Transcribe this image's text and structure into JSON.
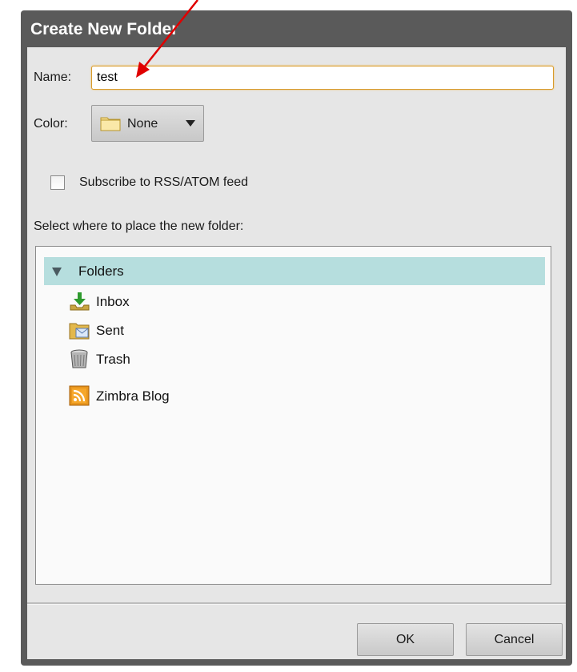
{
  "dialog": {
    "title": "Create New Folder",
    "name_label": "Name:",
    "name_value": "test",
    "color_label": "Color:",
    "color_value": "None",
    "subscribe_label": "Subscribe to RSS/ATOM feed",
    "placement_label": "Select where to place the new folder:",
    "ok_label": "OK",
    "cancel_label": "Cancel"
  },
  "tree": {
    "root": "Folders",
    "items": [
      {
        "label": "Inbox",
        "icon": "inbox-icon"
      },
      {
        "label": "Sent",
        "icon": "sent-icon"
      },
      {
        "label": "Trash",
        "icon": "trash-icon"
      },
      {
        "label": "Zimbra Blog",
        "icon": "rss-feed-icon"
      }
    ]
  },
  "colors": {
    "titlebar": "#5a5a5a",
    "tree_selected": "#b6dede",
    "annotation_arrow": "#e00000",
    "input_focus": "#d89a2a"
  }
}
